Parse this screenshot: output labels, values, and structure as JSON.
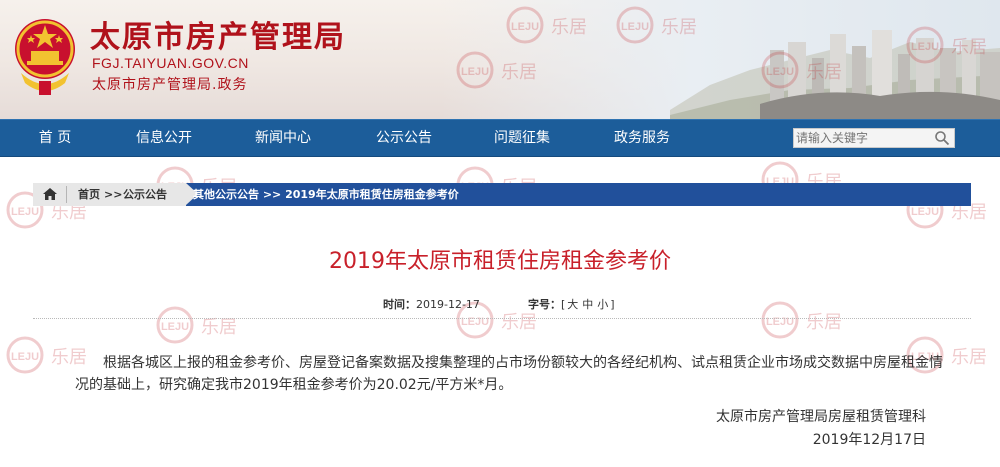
{
  "header": {
    "site_title": "太原市房产管理局",
    "site_domain": "FGJ.TAIYUAN.GOV.CN",
    "site_sub": "太原市房产管理局.政务"
  },
  "nav": {
    "items": [
      {
        "label": "首  页"
      },
      {
        "label": "信息公开"
      },
      {
        "label": "新闻中心"
      },
      {
        "label": "公示公告"
      },
      {
        "label": "问题征集"
      },
      {
        "label": "政务服务"
      }
    ],
    "search_placeholder": "请输入关键字"
  },
  "breadcrumb": {
    "home": "首页",
    "sep": ">>",
    "notice": "公示公告",
    "rest": "其他公示公告 >> 2019年太原市租赁住房租金参考价"
  },
  "article": {
    "title": "2019年太原市租赁住房租金参考价",
    "time_label": "时间：",
    "time_value": "2019-12-17",
    "size_label": "字号：",
    "size_open": "[",
    "size_large": "大",
    "size_medium": "中",
    "size_small": "小",
    "size_close": "]",
    "body": "根据各城区上报的租金参考价、房屋登记备案数据及搜集整理的占市场份额较大的各经纪机构、试点租赁企业市场成交数据中房屋租金情况的基础上，研究确定我市2019年租金参考价为20.02元/平方米*月。",
    "signature": "太原市房产管理局房屋租赁管理科",
    "sign_date": "2019年12月17日"
  },
  "watermark": {
    "text_cn": "乐居",
    "text_en": "LEJU"
  },
  "colors": {
    "brand_red": "#b0121b",
    "nav_blue": "#1c5d9a",
    "crumb_blue": "#21509b",
    "title_red": "#c8202a"
  }
}
